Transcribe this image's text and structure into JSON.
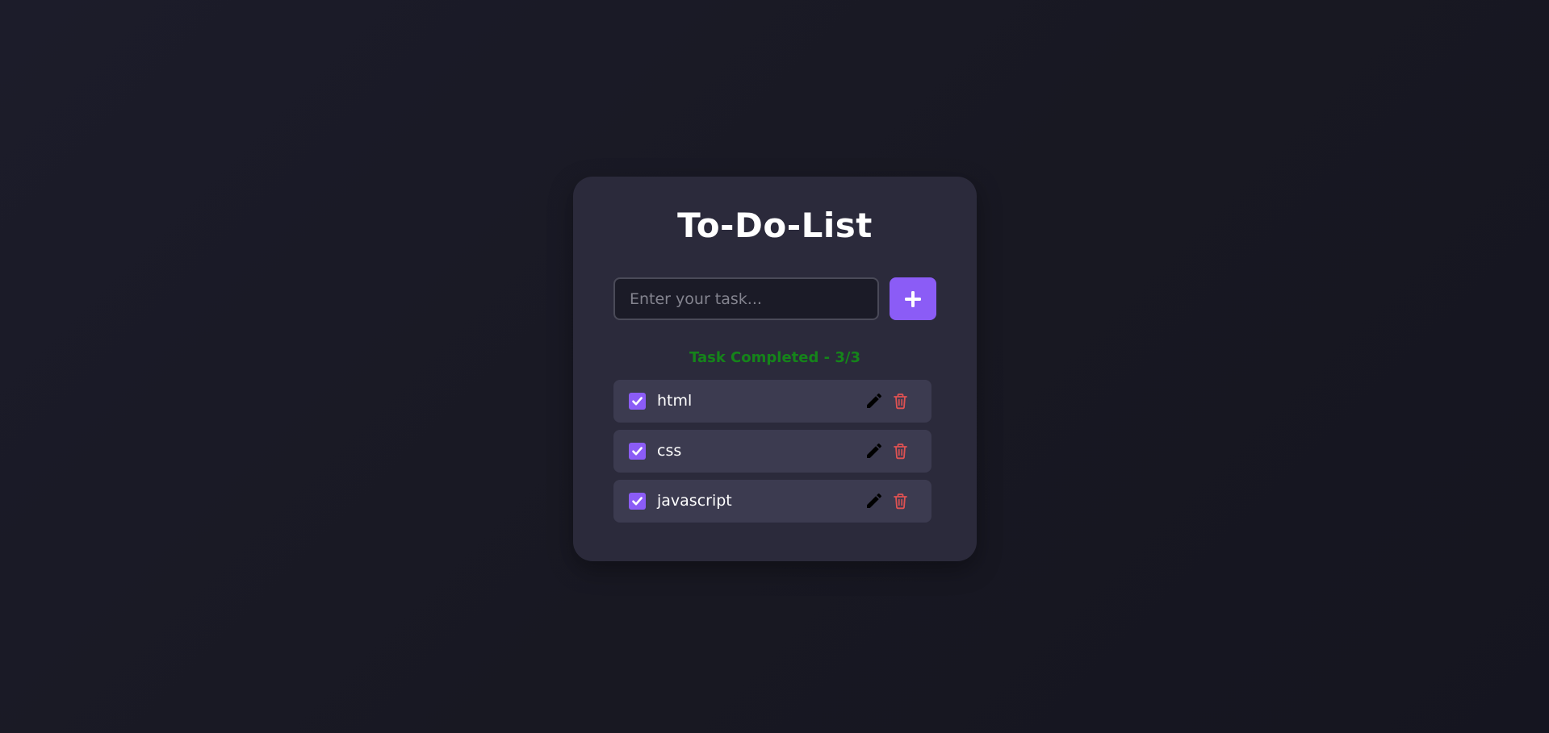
{
  "app": {
    "title": "To-Do-List"
  },
  "input": {
    "placeholder": "Enter your task...",
    "value": ""
  },
  "add_button": {
    "icon": "plus-icon"
  },
  "status": {
    "text": "Task Completed - 3/3",
    "completed": 3,
    "total": 3
  },
  "tasks": [
    {
      "label": "html",
      "checked": true
    },
    {
      "label": "css",
      "checked": true
    },
    {
      "label": "javascript",
      "checked": true
    }
  ],
  "icons": {
    "edit": "pencil-icon",
    "delete": "trash-icon",
    "check": "checkmark-icon"
  },
  "colors": {
    "accent": "#8b5cf6",
    "status_text": "#15841a",
    "delete": "#e05252",
    "edit": "#000000",
    "card": "#2b2a3b",
    "item": "#3c3b50"
  }
}
